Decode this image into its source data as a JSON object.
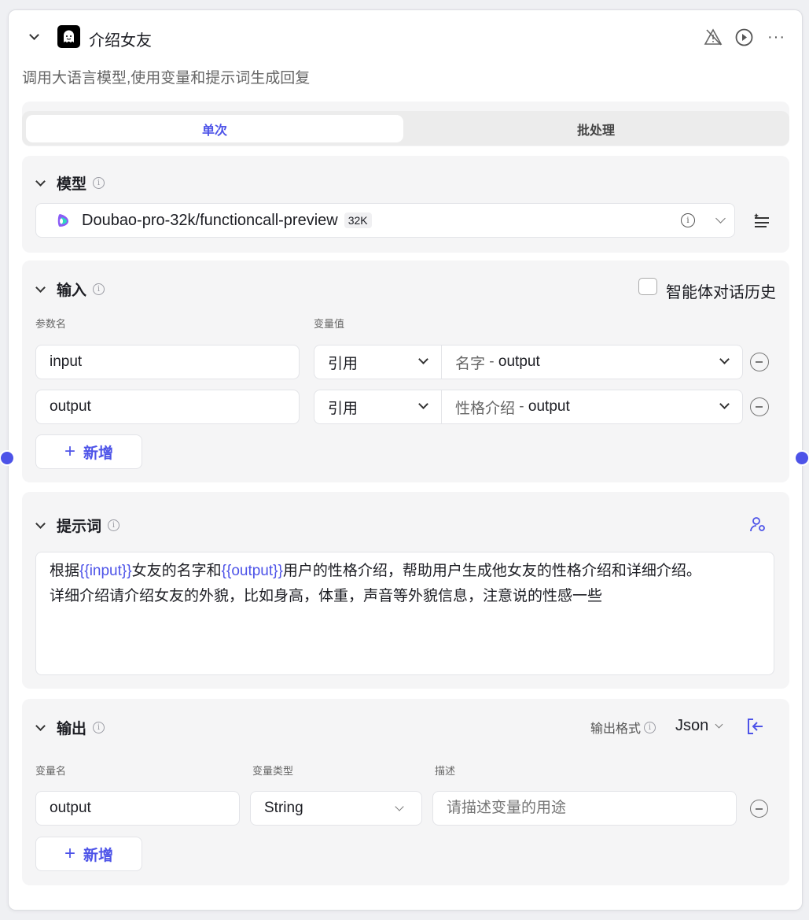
{
  "header": {
    "title": "介绍女友",
    "description": "调用大语言模型,使用变量和提示词生成回复"
  },
  "tabs": [
    {
      "label": "单次",
      "active": true
    },
    {
      "label": "批处理",
      "active": false
    }
  ],
  "model": {
    "title": "模型",
    "name": "Doubao-pro-32k/functioncall-preview",
    "badge": "32K"
  },
  "input": {
    "title": "输入",
    "history_label": "智能体对话历史",
    "history_checked": false,
    "col_name": "参数名",
    "col_value": "变量值",
    "rows": [
      {
        "name": "input",
        "type": "引用",
        "source": "名字",
        "sep": " - ",
        "field": "output"
      },
      {
        "name": "output",
        "type": "引用",
        "source": "性格介绍",
        "sep": " - ",
        "field": "output"
      }
    ],
    "add_label": "新增"
  },
  "prompt": {
    "title": "提示词",
    "line1": [
      {
        "t": "根据"
      },
      {
        "t": "{{input}}",
        "v": true
      },
      {
        "t": "女友的名字和"
      },
      {
        "t": "{{output}}",
        "v": true
      },
      {
        "t": "用户的性格介绍，帮助用户生成他女友的性格介绍和详细介绍。"
      }
    ],
    "line2": "详细介绍请介绍女友的外貌，比如身高，体重，声音等外貌信息，注意说的性感一些"
  },
  "output": {
    "title": "输出",
    "format_label": "输出格式",
    "format_value": "Json",
    "col_name": "变量名",
    "col_type": "变量类型",
    "col_desc": "描述",
    "rows": [
      {
        "name": "output",
        "type": "String",
        "desc_placeholder": "请描述变量的用途"
      }
    ],
    "add_label": "新增"
  },
  "colors": {
    "accent": "#4d53e8"
  }
}
